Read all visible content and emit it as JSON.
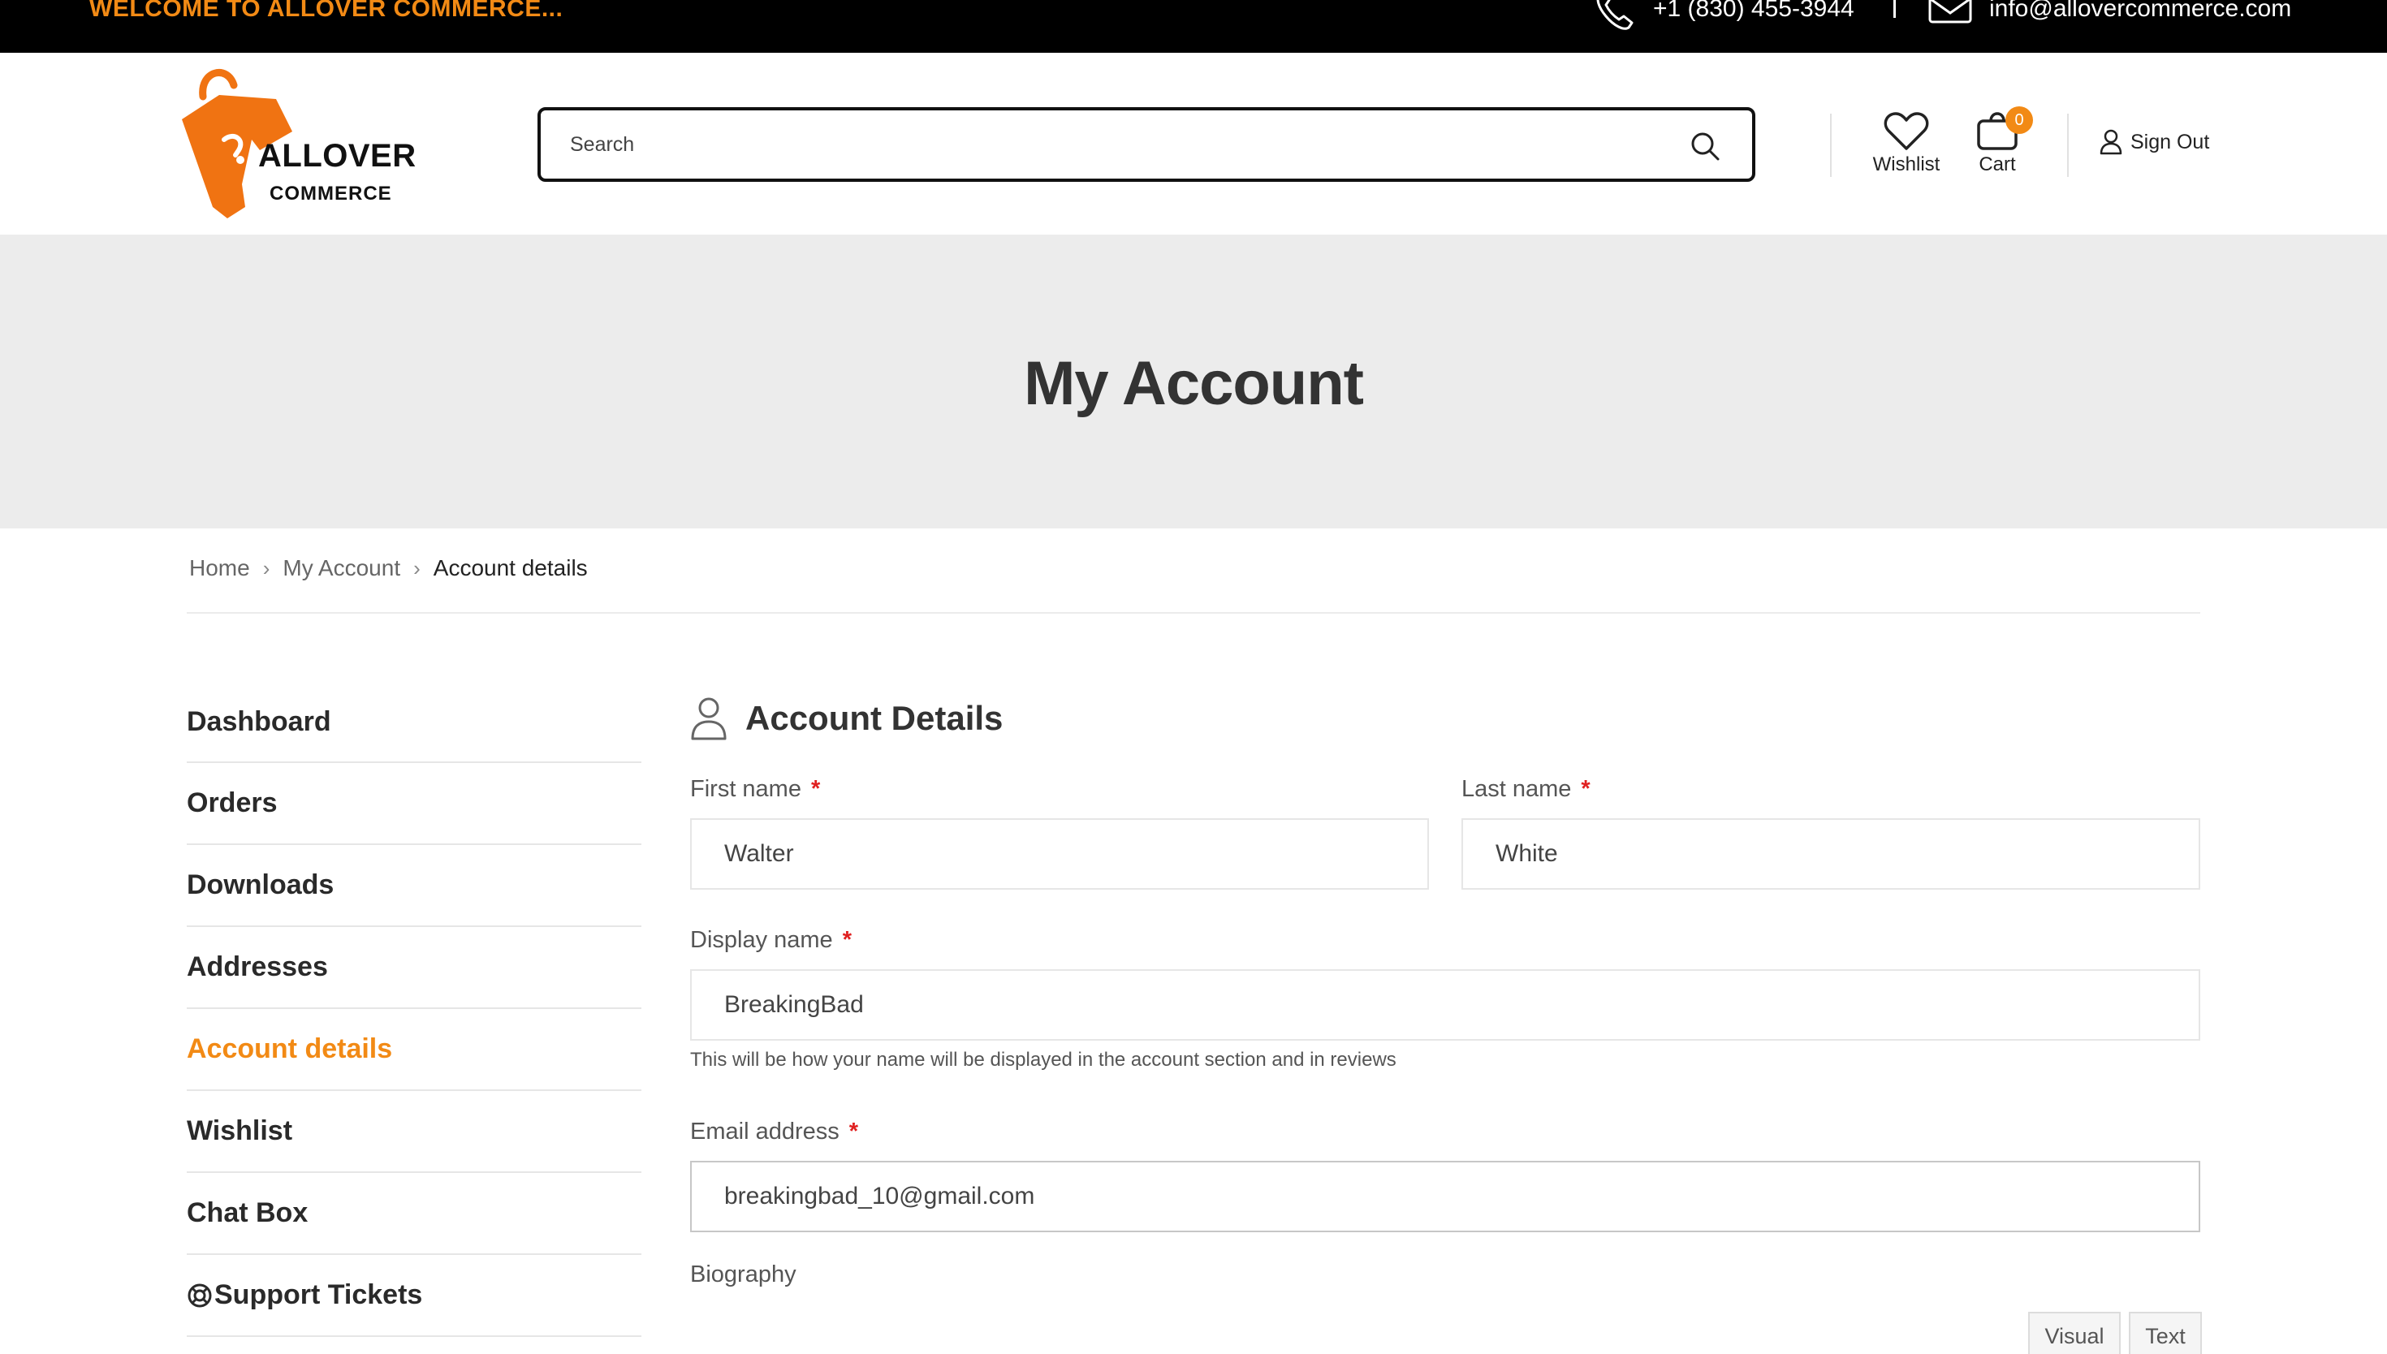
{
  "topbar": {
    "welcome": "WELCOME TO ALLOVER COMMERCE...",
    "phone": "+1 (830) 455-3944",
    "email": "info@allovercommerce.com",
    "phone_icon": "phone-icon",
    "mail_icon": "mail-icon"
  },
  "header": {
    "logo_line1": "ALLOVER",
    "logo_line2": "COMMERCE",
    "search_placeholder": "Search",
    "wishlist_label": "Wishlist",
    "cart_label": "Cart",
    "cart_count": "0",
    "signout_label": "Sign Out"
  },
  "banner": {
    "title": "My Account"
  },
  "breadcrumb": {
    "items": [
      "Home",
      "My Account",
      "Account details"
    ]
  },
  "sidebar": {
    "items": [
      {
        "label": "Dashboard",
        "active": false
      },
      {
        "label": "Orders",
        "active": false
      },
      {
        "label": "Downloads",
        "active": false
      },
      {
        "label": "Addresses",
        "active": false
      },
      {
        "label": "Account details",
        "active": true
      },
      {
        "label": "Wishlist",
        "active": false
      },
      {
        "label": "Chat Box",
        "active": false
      },
      {
        "label": "Support Tickets",
        "active": false
      }
    ]
  },
  "account": {
    "title": "Account Details",
    "first_name_label": "First name",
    "first_name_value": "Walter",
    "last_name_label": "Last name",
    "last_name_value": "White",
    "display_name_label": "Display name",
    "display_name_value": "BreakingBad",
    "display_name_help": "This will be how your name will be displayed in the account section and in reviews",
    "email_label": "Email address",
    "email_value": "breakingbad_10@gmail.com",
    "biography_label": "Biography",
    "required_mark": "*",
    "editor_tabs": [
      "Visual",
      "Text"
    ]
  },
  "colors": {
    "accent": "#f28a15",
    "required": "#e02020",
    "topbar_bg": "#000000",
    "banner_bg": "#ececec"
  }
}
